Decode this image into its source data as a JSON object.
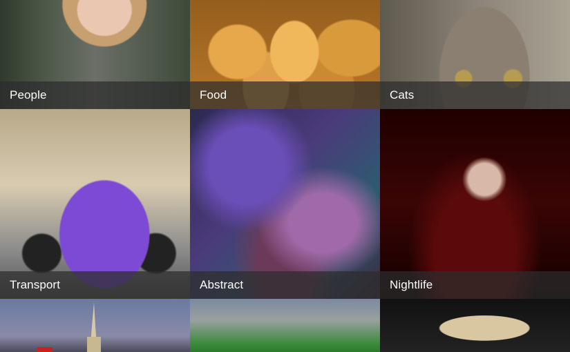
{
  "categories": [
    {
      "label": "People"
    },
    {
      "label": "Food"
    },
    {
      "label": "Cats"
    },
    {
      "label": "Transport"
    },
    {
      "label": "Abstract"
    },
    {
      "label": "Nightlife"
    },
    {
      "label": ""
    },
    {
      "label": ""
    },
    {
      "label": ""
    }
  ]
}
